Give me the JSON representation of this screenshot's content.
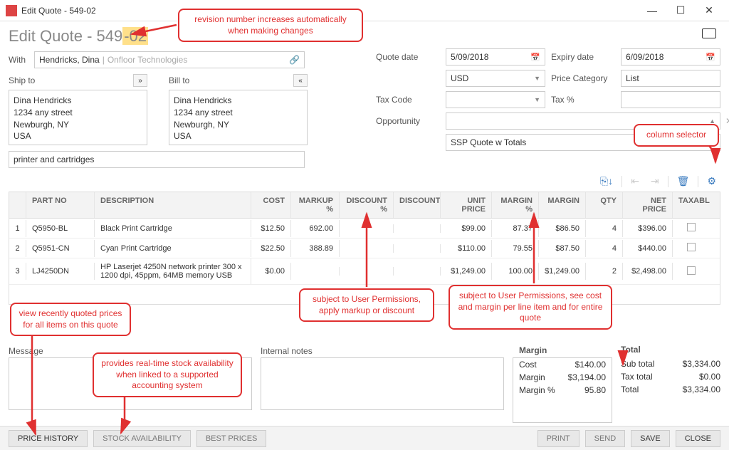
{
  "window": {
    "title": "Edit Quote - 549-02"
  },
  "header": {
    "title_prefix": "Edit Quote - 549",
    "title_rev": "-02"
  },
  "with": {
    "label": "With",
    "name": "Hendricks, Dina",
    "company": "Onfloor Technologies"
  },
  "ship": {
    "label": "Ship to",
    "addr1": "Dina Hendricks",
    "addr2": "1234 any street",
    "addr3": "Newburgh, NY",
    "addr4": "USA"
  },
  "bill": {
    "label": "Bill to",
    "addr1": "Dina Hendricks",
    "addr2": "1234 any street",
    "addr3": "Newburgh, NY",
    "addr4": "USA"
  },
  "subject": "printer and cartridges",
  "fields": {
    "quote_date_label": "Quote date",
    "quote_date": "5/09/2018",
    "expiry_label": "Expiry date",
    "expiry_date": "6/09/2018",
    "currency": "USD",
    "price_cat_label": "Price Category",
    "price_cat": "List",
    "tax_code_label": "Tax Code",
    "tax_pct_label": "Tax %",
    "opp_label": "Opportunity",
    "template": "SSP Quote w Totals"
  },
  "columns": {
    "part": "PART NO",
    "desc": "DESCRIPTION",
    "cost": "COST",
    "markup": "MARKUP %",
    "discp": "DISCOUNT %",
    "disc": "DISCOUNT",
    "unit": "UNIT PRICE",
    "marginp": "MARGIN %",
    "margin": "MARGIN",
    "qty": "QTY",
    "net": "NET PRICE",
    "tax": "TAXABLE"
  },
  "rows": [
    {
      "n": "1",
      "part": "Q5950-BL",
      "desc": "Black Print Cartridge",
      "cost": "$12.50",
      "markup": "692.00",
      "unit": "$99.00",
      "marginp": "87.37",
      "margin": "$86.50",
      "qty": "4",
      "net": "$396.00"
    },
    {
      "n": "2",
      "part": "Q5951-CN",
      "desc": "Cyan Print Cartridge",
      "cost": "$22.50",
      "markup": "388.89",
      "unit": "$110.00",
      "marginp": "79.55",
      "margin": "$87.50",
      "qty": "4",
      "net": "$440.00"
    },
    {
      "n": "3",
      "part": "LJ4250DN",
      "desc": "HP Laserjet 4250N network printer  300 x 1200 dpi, 45ppm, 64MB memory USB",
      "cost": "$0.00",
      "markup": "",
      "unit": "$1,249.00",
      "marginp": "100.00",
      "margin": "$1,249.00",
      "qty": "2",
      "net": "$2,498.00"
    }
  ],
  "bottom": {
    "msg_label": "Message",
    "notes_label": "Internal notes",
    "margin_title": "Margin",
    "margin_cost_label": "Cost",
    "margin_cost": "$140.00",
    "margin_val_label": "Margin",
    "margin_val": "$3,194.00",
    "margin_pct_label": "Margin %",
    "margin_pct": "95.80",
    "total_title": "Total",
    "subtotal_label": "Sub total",
    "subtotal": "$3,334.00",
    "taxtotal_label": "Tax total",
    "taxtotal": "$0.00",
    "total_label": "Total",
    "total": "$3,334.00"
  },
  "footer": {
    "price_history": "PRICE HISTORY",
    "stock": "STOCK AVAILABILITY",
    "best": "BEST PRICES",
    "print": "PRINT",
    "send": "SEND",
    "save": "SAVE",
    "close": "CLOSE"
  },
  "callouts": {
    "rev": "revision number increases automatically when making changes",
    "colsel": "column selector",
    "markup": "subject to User Permissions, apply markup or discount",
    "margin": "subject to User Permissions, see cost and margin per line item and for entire quote",
    "history": "view recently quoted prices for all items on this quote",
    "stock": "provides real-time stock availability when linked to a supported accounting system"
  }
}
